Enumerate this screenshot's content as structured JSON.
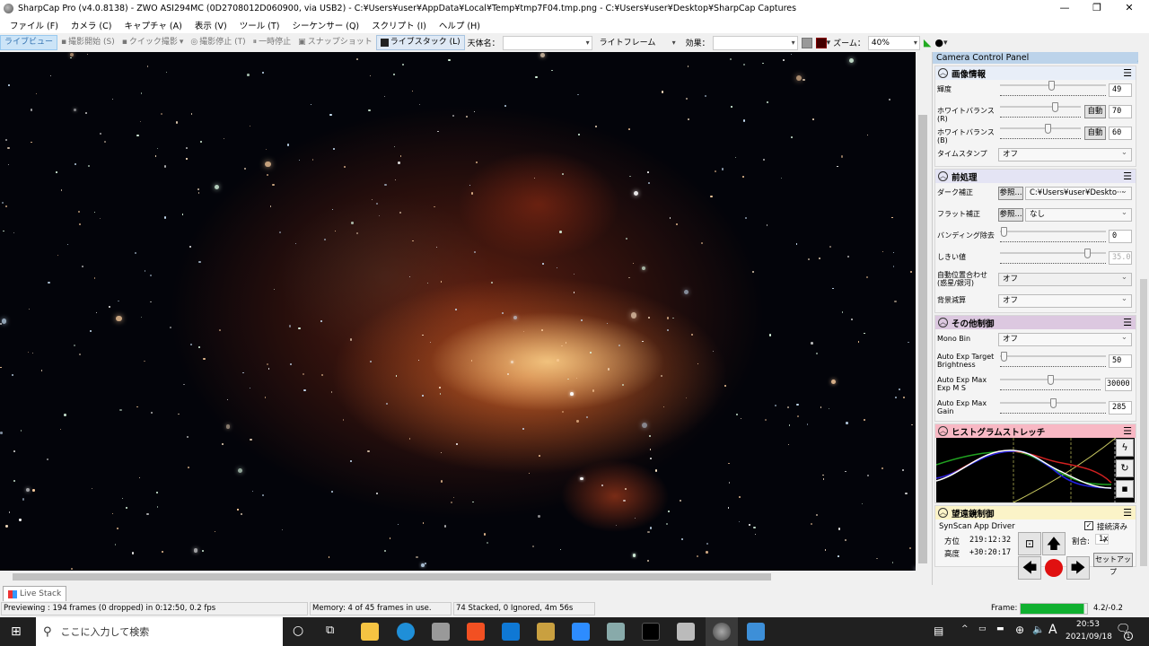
{
  "window": {
    "title": "SharpCap Pro (v4.0.8138) - ZWO ASI294MC (0D2708012D060900, via USB2) - C:¥Users¥user¥AppData¥Local¥Temp¥tmp7F04.tmp.png - C:¥Users¥user¥Desktop¥SharpCap Captures",
    "minimize": "—",
    "restore": "❐",
    "close": "✕"
  },
  "menu": [
    "ファイル (F)",
    "カメラ (C)",
    "キャプチャ (A)",
    "表示 (V)",
    "ツール (T)",
    "シーケンサー (Q)",
    "スクリプト (I)",
    "ヘルプ (H)"
  ],
  "toolbar": {
    "live_view": "ライブビュー",
    "start_capture": "撮影開始 (S)",
    "quick_capture": "クイック撮影",
    "stop_capture": "撮影停止 (T)",
    "pause": "一時停止",
    "snapshot": "スナップショット",
    "live_stack": "ライブスタック (L)",
    "target_label": "天体名：",
    "target_value": "",
    "frame_type": "ライトフレーム",
    "effect_label": "効果：",
    "effect_value": "",
    "zoom_label": "ズーム：",
    "zoom_value": "40%"
  },
  "panel": {
    "title": "Camera Control Panel",
    "image": {
      "title": "画像情報",
      "brightness_label": "輝度",
      "brightness": "49",
      "brightness_level": 0.49,
      "wbr_label": "ホワイトバランス(R)",
      "wbr": "70",
      "wbr_level": 0.7,
      "wbb_label": "ホワイトバランス(B)",
      "wbb": "60",
      "wbb_level": 0.6,
      "auto": "自動",
      "timestamp_label": "タイムスタンプ",
      "timestamp": "オフ"
    },
    "pre": {
      "title": "前処理",
      "dark_label": "ダーク補正",
      "browse": "参照...",
      "dark_value": "C:¥Users¥user¥Deskto···",
      "flat_label": "フラット補正",
      "flat_value": "なし",
      "banding_label": "バンディング除去",
      "banding": "0",
      "banding_level": 0,
      "threshold_label": "しきい値",
      "threshold": "35.0",
      "threshold_level": 0.85,
      "align_label": "自動位置合わせ (惑星/銀河)",
      "align": "オフ",
      "bg_label": "背景減算",
      "bg": "オフ"
    },
    "misc": {
      "title": "その他制御",
      "monobin_label": "Mono Bin",
      "monobin": "オフ",
      "aet_label": "Auto Exp Target Brightness",
      "aet": "50",
      "aet_level": 0,
      "aem_label": "Auto Exp Max Exp M S",
      "aem": "30000",
      "aem_level": 0.5,
      "aeg_label": "Auto Exp Max Gain",
      "aeg": "285",
      "aeg_level": 0.5
    },
    "hist": {
      "title": "ヒストグラムストレッチ",
      "colors": {
        "red": "#d02020",
        "green": "#20a020",
        "blue": "#2020e0",
        "white": "#ffffff",
        "curve": "#c8c860"
      }
    },
    "scope": {
      "title": "望遠鏡制御",
      "driver": "SynScan App Driver",
      "connected_label": "接続済み",
      "connected": true,
      "az_label": "方位",
      "az": "219:12:32",
      "alt_label": "高度",
      "alt": "+30:20:17",
      "rate_label": "割合:",
      "rate": "1x",
      "setup": "セットアップ"
    }
  },
  "tab": {
    "live_stack": "Live Stack"
  },
  "status": {
    "preview": "Previewing : 194 frames (0 dropped) in 0:12:50, 0.2 fps",
    "memory": "Memory: 4 of 45 frames in use.",
    "stacked": "74 Stacked, 0 Ignored, 4m 56s",
    "frame_label": "Frame:",
    "frame_value": "4.2/-0.2",
    "frame_color": "#10b030"
  },
  "taskbar": {
    "search_placeholder": "ここに入力して検索",
    "time": "20:53",
    "date": "2021/09/18",
    "ime": "A",
    "notifications": "1"
  }
}
